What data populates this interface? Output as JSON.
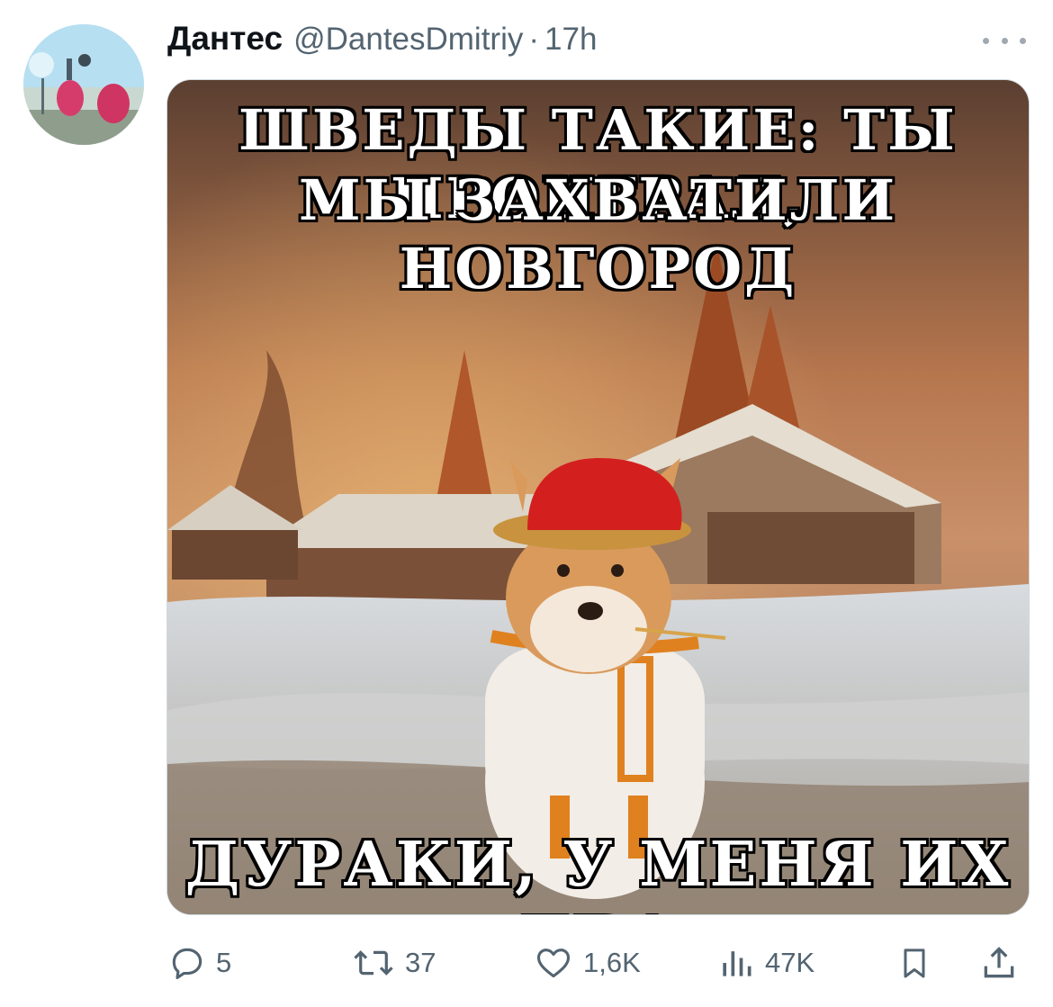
{
  "tweet": {
    "author_name": "Дантес",
    "handle": "@DantesDmitriy",
    "separator": "·",
    "time": "17h"
  },
  "media": {
    "top_text_line1": "ШВЕДЫ ТАКИЕ: ТЫ ПРОИГРАЛ,",
    "top_text_line2": "МЫ ЗАХВАТИЛИ НОВГОРОД",
    "bottom_text": "ДУРАКИ, У МЕНЯ ИХ ДВА"
  },
  "actions": {
    "replies": "5",
    "reposts": "37",
    "likes": "1,6K",
    "views": "47K"
  },
  "icons": [
    "more-icon",
    "reply-icon",
    "repost-icon",
    "like-icon",
    "views-icon",
    "bookmark-icon",
    "share-icon"
  ],
  "colors": {
    "text_primary": "#0f1419",
    "text_secondary": "#536471",
    "border": "#cfd9de"
  }
}
